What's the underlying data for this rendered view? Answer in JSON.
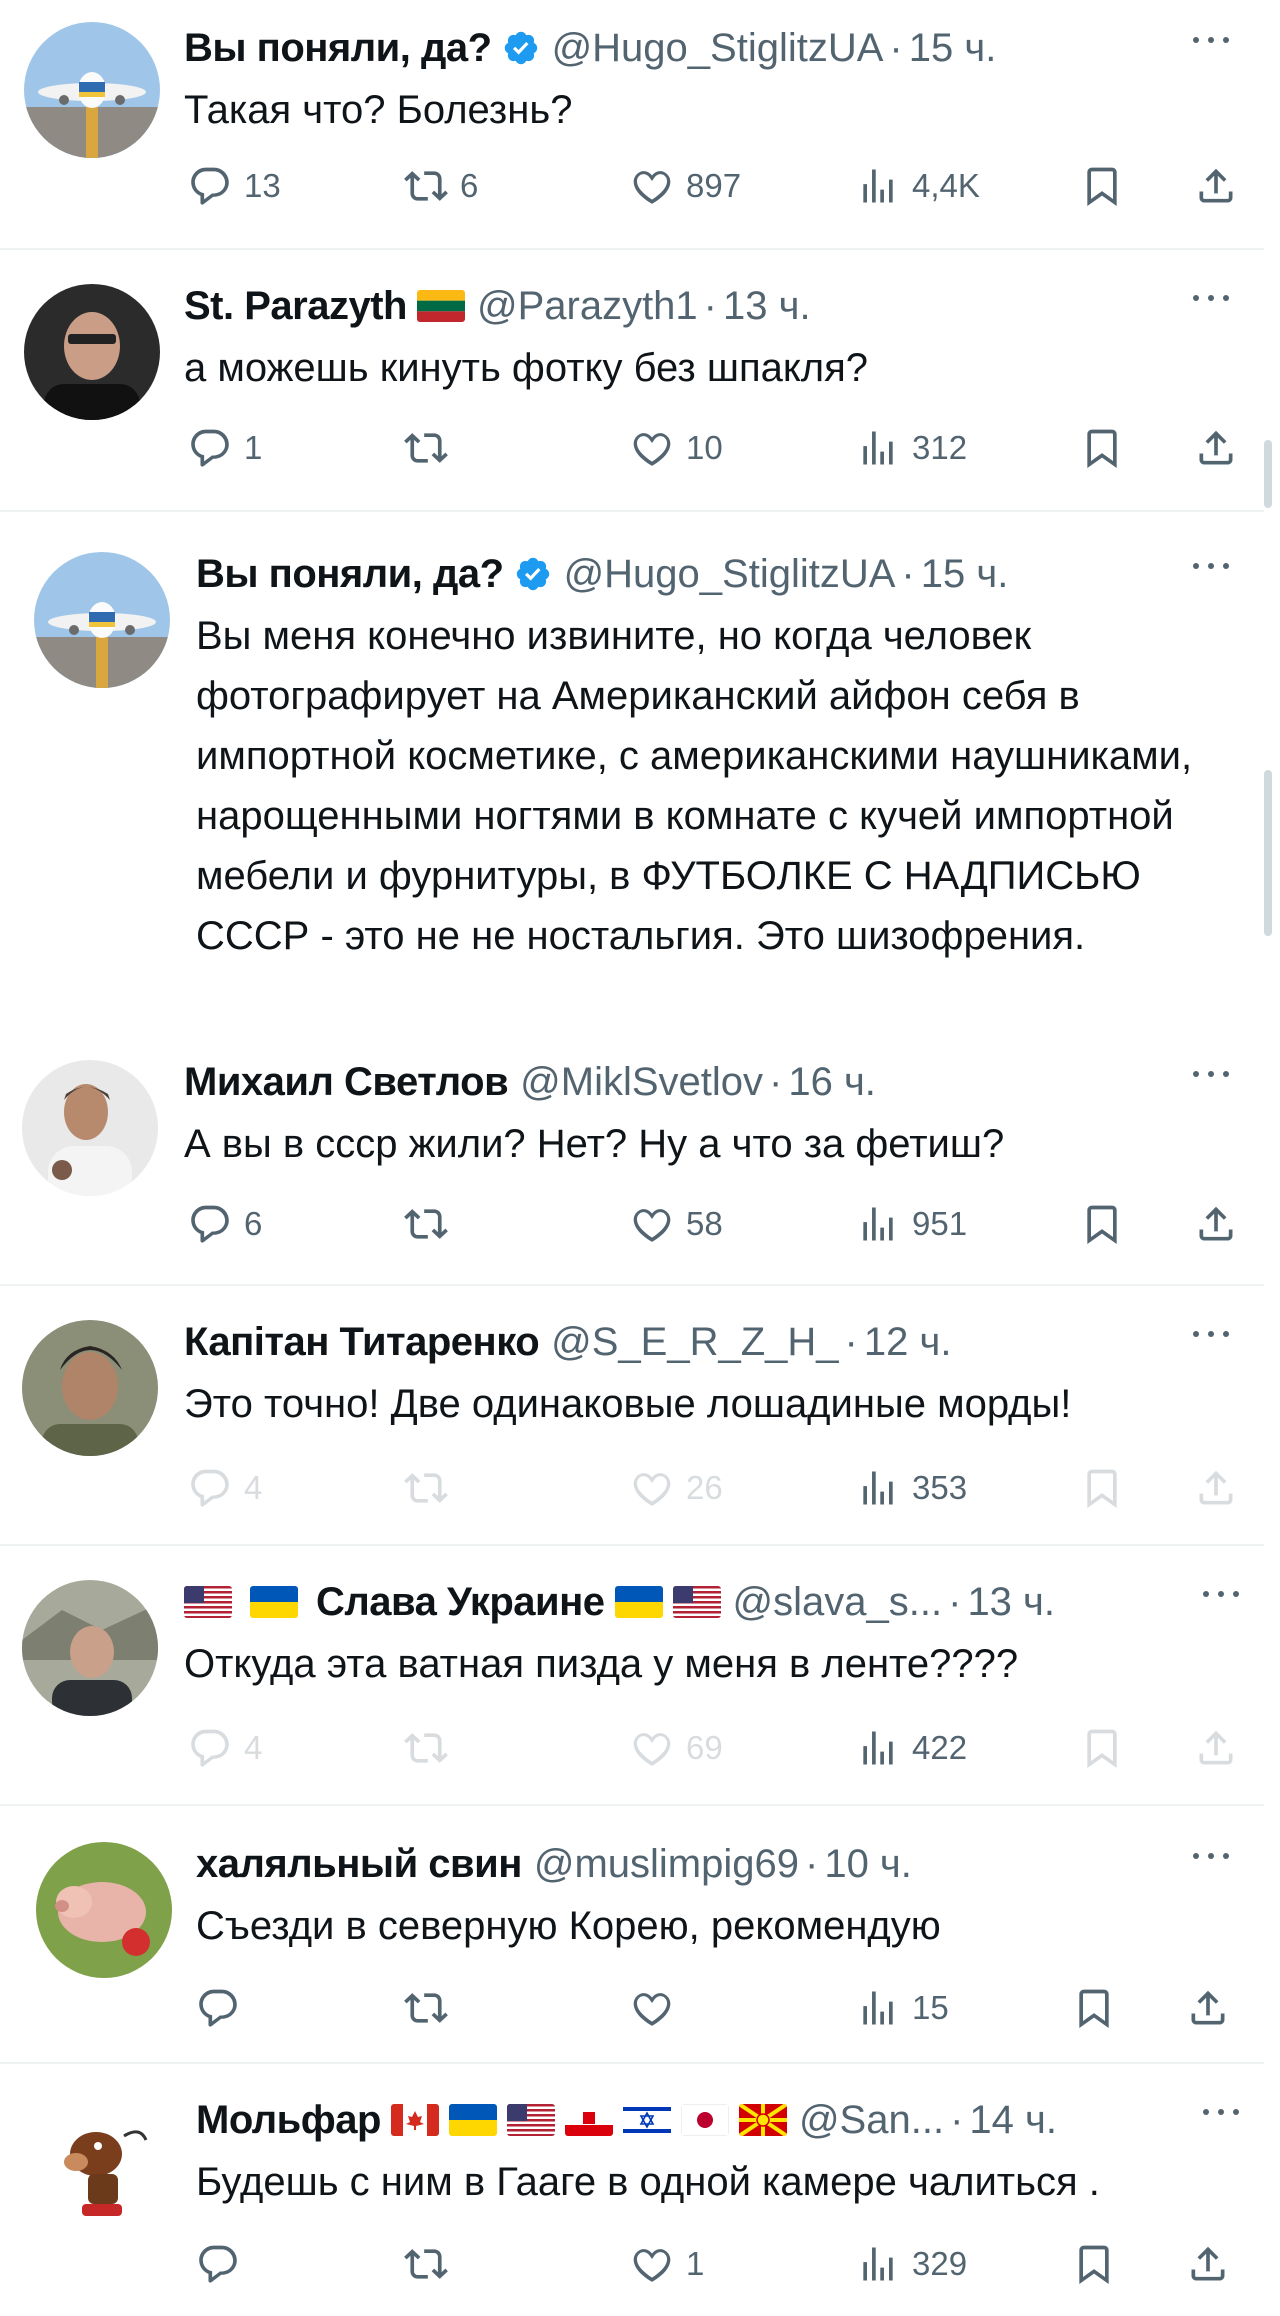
{
  "tweets": [
    {
      "name": "Вы поняли, да?",
      "verified": true,
      "handle": "@Hugo_StiglitzUA",
      "time": "15 ч.",
      "text": "Такая что? Болезнь?",
      "replies": "13",
      "retweets": "6",
      "likes": "897",
      "views": "4,4K"
    },
    {
      "name": "St. Parazyth",
      "flags": [
        "lithuania"
      ],
      "handle": "@Parazyth1",
      "time": "13 ч.",
      "text": "а можешь кинуть фотку без шпакля?",
      "replies": "1",
      "retweets": "",
      "likes": "10",
      "views": "312"
    },
    {
      "name": "Вы поняли, да?",
      "verified": true,
      "handle": "@Hugo_StiglitzUA",
      "time": "15 ч.",
      "text": "Вы меня конечно извините, но когда человек фотографирует на Американский айфон себя в импортной косметике, с американскими наушниками, нарощенными ногтями в комнате с кучей импортной мебели и фурнитуры, в ФУТБОЛКЕ С НАДПИСЬЮ СССР - это не не ностальгия. Это шизофрения."
    },
    {
      "name": "Михаил Светлов",
      "handle": "@MiklSvetlov",
      "time": "16 ч.",
      "text": "А вы в ссср жили? Нет? Ну а что за фетиш?",
      "replies": "6",
      "retweets": "",
      "likes": "58",
      "views": "951"
    },
    {
      "name": "Капітан Титаренко",
      "handle": "@S_E_R_Z_H_",
      "time": "12 ч.",
      "text": "Это точно! Две одинаковые лошадиные морды!",
      "replies": "4",
      "retweets": "",
      "likes": "26",
      "views": "353"
    },
    {
      "name": "Слава Украине",
      "lead_flags": [
        "usa",
        "ukraine"
      ],
      "flags": [
        "ukraine",
        "usa"
      ],
      "handle": "@slava_s...",
      "time": "13 ч.",
      "text": "Откуда эта ватная пизда у меня в ленте????",
      "replies": "4",
      "retweets": "",
      "likes": "69",
      "views": "422"
    },
    {
      "name": "халяльный свин",
      "handle": "@muslimpig69",
      "time": "10 ч.",
      "text": "Съезди в северную Корею, рекомендую",
      "replies": "",
      "retweets": "",
      "likes": "",
      "views": "15"
    },
    {
      "name": "Мольфар",
      "flags": [
        "canada",
        "ukraine",
        "usa",
        "gibraltar",
        "israel",
        "japan",
        "macedonia"
      ],
      "handle": "@San...",
      "time": "14 ч.",
      "text": "Будешь с ним в Гааге в одной камере чалиться .",
      "replies": "",
      "retweets": "",
      "likes": "1",
      "views": "329"
    }
  ],
  "icons": {
    "reply": "reply-icon",
    "retweet": "retweet-icon",
    "like": "heart-icon",
    "views": "views-icon",
    "bookmark": "bookmark-icon",
    "share": "share-icon",
    "more": "more-icon",
    "verified": "verified-badge-icon"
  },
  "colors": {
    "text": "#0f1419",
    "secondary": "#536471",
    "verified": "#1d9bf0",
    "divider": "#eff3f4"
  }
}
